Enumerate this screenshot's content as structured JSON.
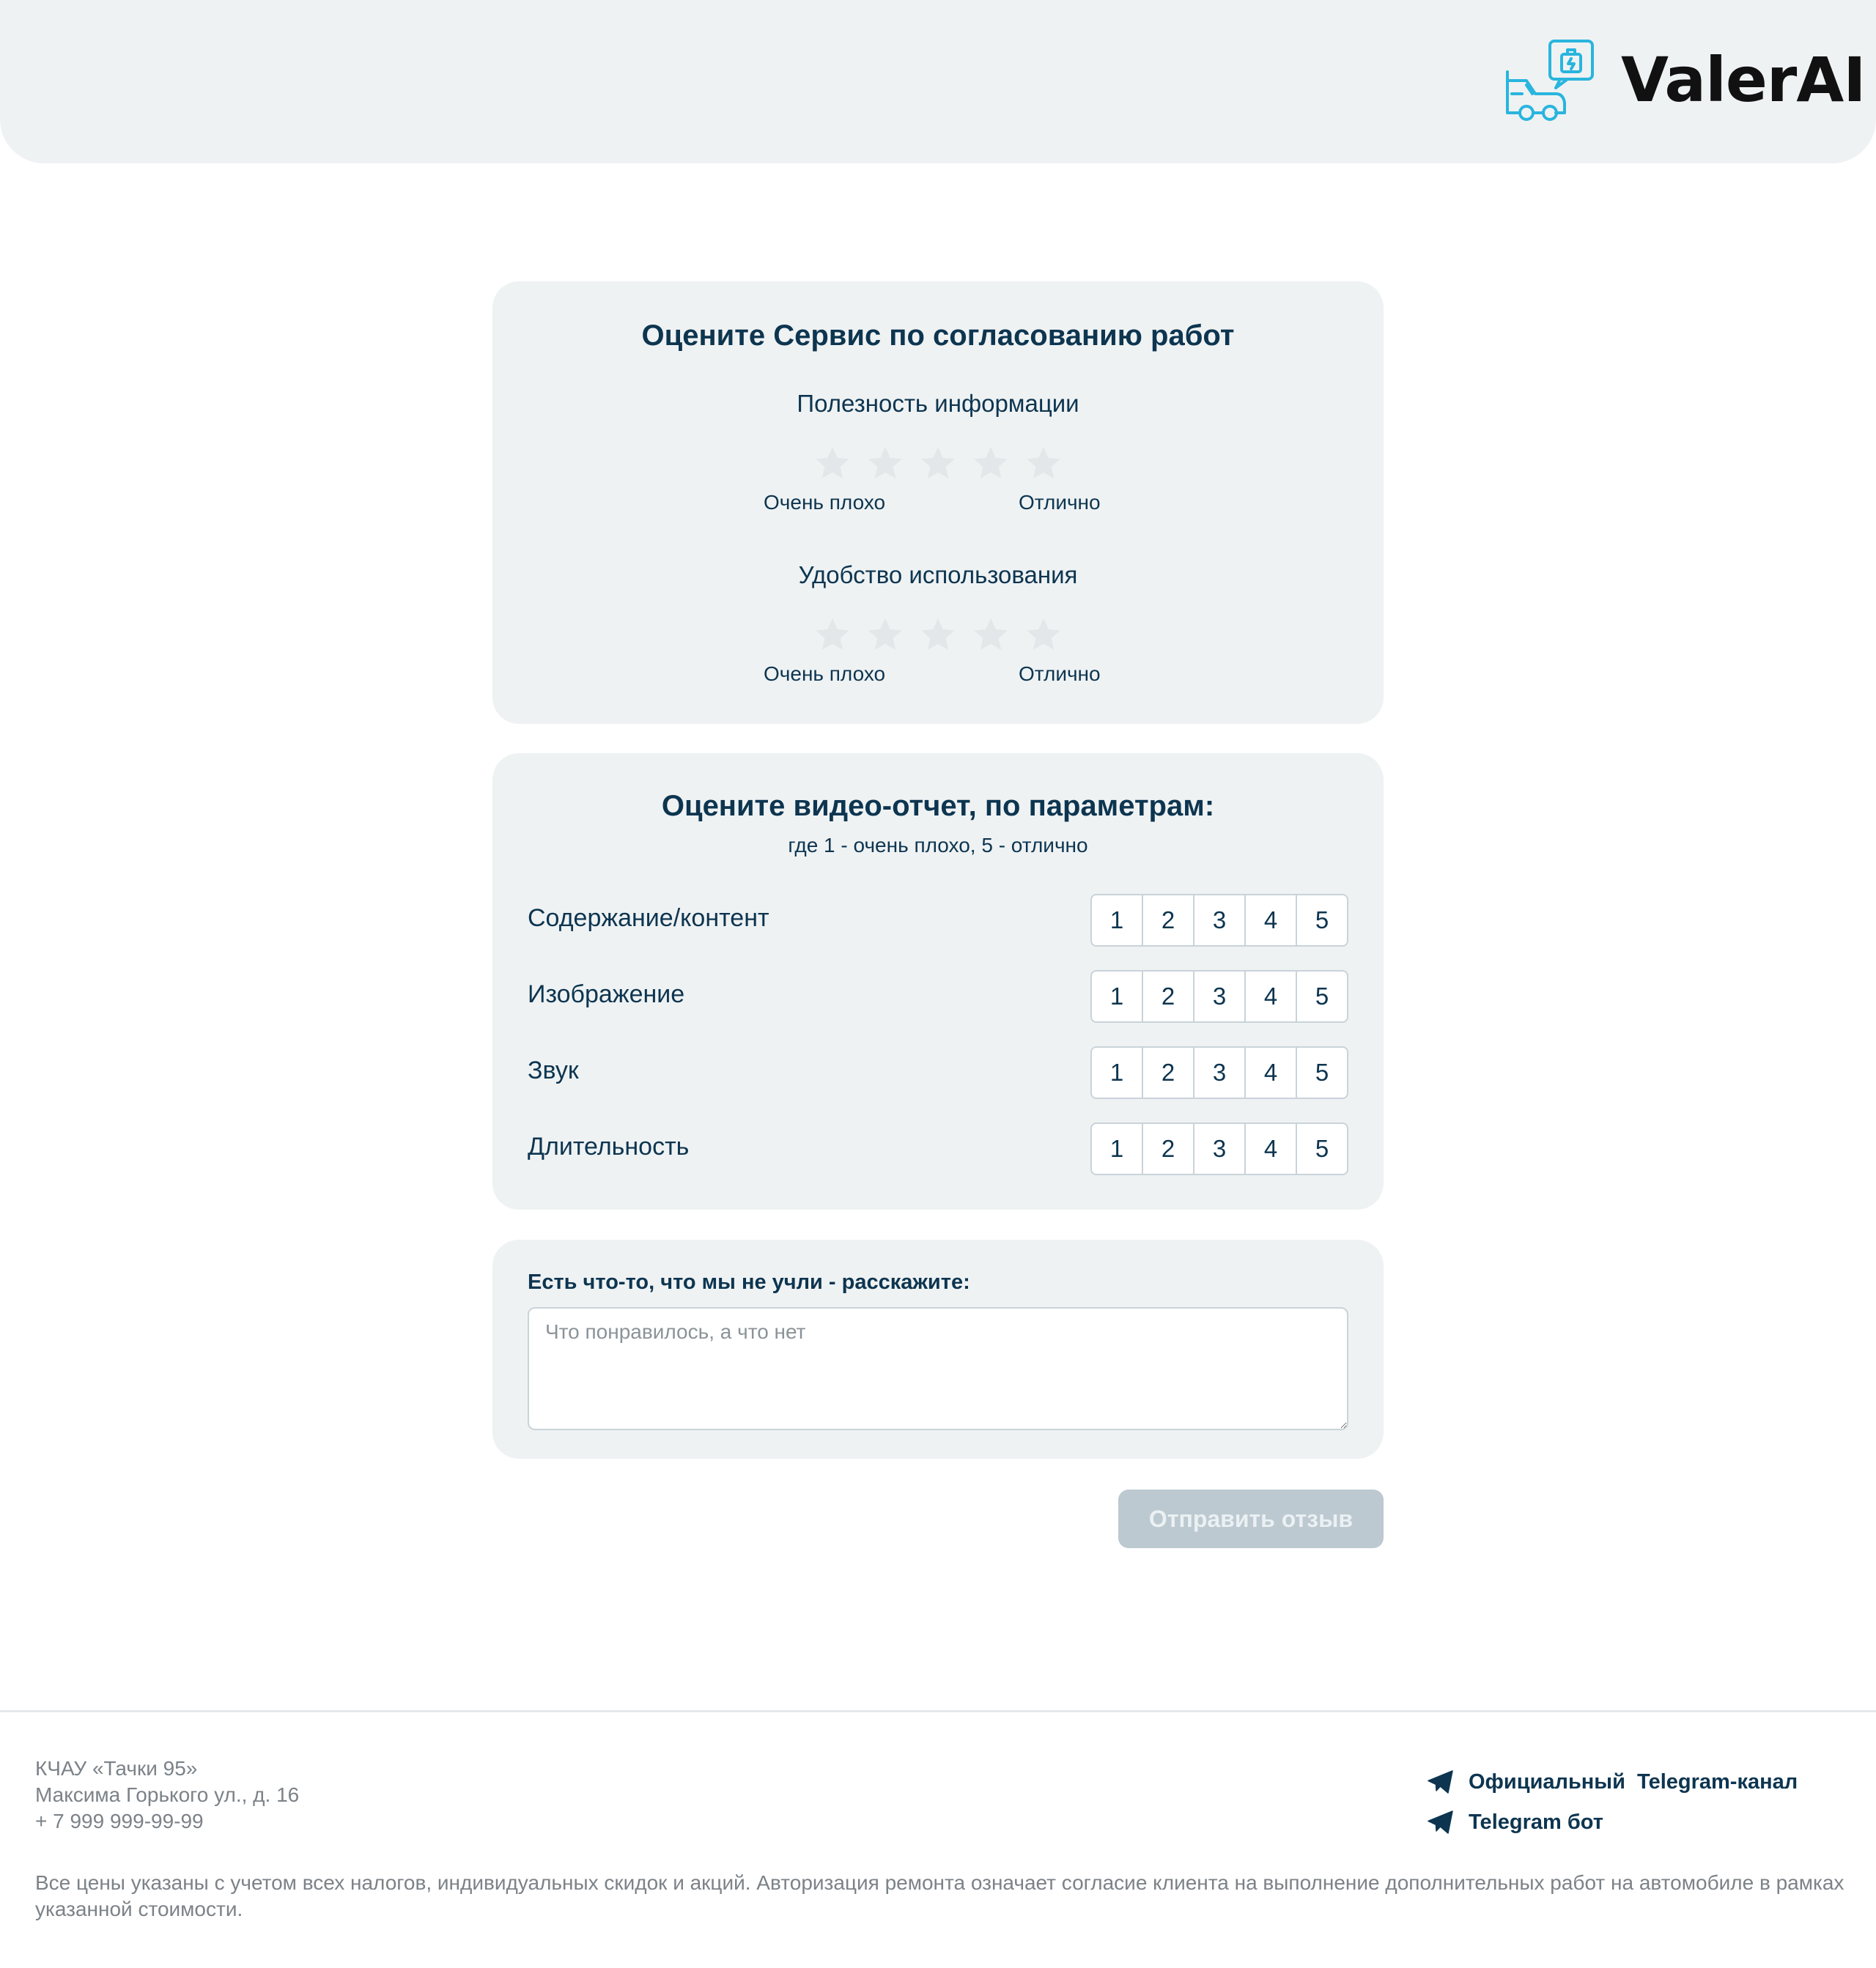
{
  "header": {
    "brand": "ValerAI",
    "logo_icon": "car-service-chat-icon",
    "accent_color": "#29b5de"
  },
  "service_card": {
    "title": "Оцените Сервис по согласованию работ",
    "groups": [
      {
        "label": "Полезность информации",
        "stars": 5,
        "rating": 0,
        "low": "Очень плохо",
        "high": "Отлично"
      },
      {
        "label": "Удобство использования",
        "stars": 5,
        "rating": 0,
        "low": "Очень плохо",
        "high": "Отлично"
      }
    ],
    "star_empty_color": "#e3e7ea"
  },
  "video_card": {
    "title": "Оцените видео-отчет, по параметрам:",
    "subtitle": "где 1 - очень плохо, 5 - отлично",
    "scale": [
      "1",
      "2",
      "3",
      "4",
      "5"
    ],
    "rows": [
      {
        "label": "Содержание/контент"
      },
      {
        "label": "Изображение"
      },
      {
        "label": "Звук"
      },
      {
        "label": "Длительность"
      }
    ]
  },
  "comment_card": {
    "label": "Есть что-то, что мы не учли - расскажите:",
    "placeholder": "Что понравилось, а что нет",
    "value": ""
  },
  "submit": {
    "label": "Отправить отзыв",
    "disabled": true
  },
  "footer": {
    "company": "КЧАУ «Тачки 95»",
    "address": "Максима Горького ул., д. 16",
    "phone": "+ 7 999 999-99-99",
    "links": [
      {
        "label": "Официальный  Telegram-канал",
        "icon": "telegram-icon"
      },
      {
        "label": "Telegram бот",
        "icon": "telegram-icon"
      }
    ],
    "disclaimer": "Все цены указаны с учетом всех налогов, индивидуальных скидок и акций. Авторизация ремонта означает согласие клиента на выполнение дополнительных работ на автомобиле в рамках указанной стоимости."
  }
}
